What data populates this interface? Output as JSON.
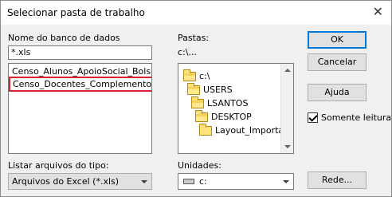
{
  "window": {
    "title": "Selecionar pasta de trabalho"
  },
  "database_name": {
    "label": "Nome do banco de dados",
    "value": "*.xls",
    "files": [
      "Censo_Alunos_ApoioSocial_Bolsas",
      "Censo_Docentes_Complemento.xlsx"
    ]
  },
  "folders": {
    "label": "Pastas:",
    "current_path": "c:\\...",
    "tree": [
      "c:\\",
      "USERS",
      "LSANTOS",
      "DESKTOP",
      "Layout_Importação"
    ]
  },
  "file_type": {
    "label": "Listar arquivos do tipo:",
    "selected": "Arquivos do Excel (*.xls)"
  },
  "drives": {
    "label": "Unidades:",
    "selected": "c:"
  },
  "buttons": {
    "ok": "OK",
    "cancel": "Cancelar",
    "help": "Ajuda",
    "network": "Rede..."
  },
  "read_only": {
    "label": "Somente leitura",
    "checked": true
  }
}
